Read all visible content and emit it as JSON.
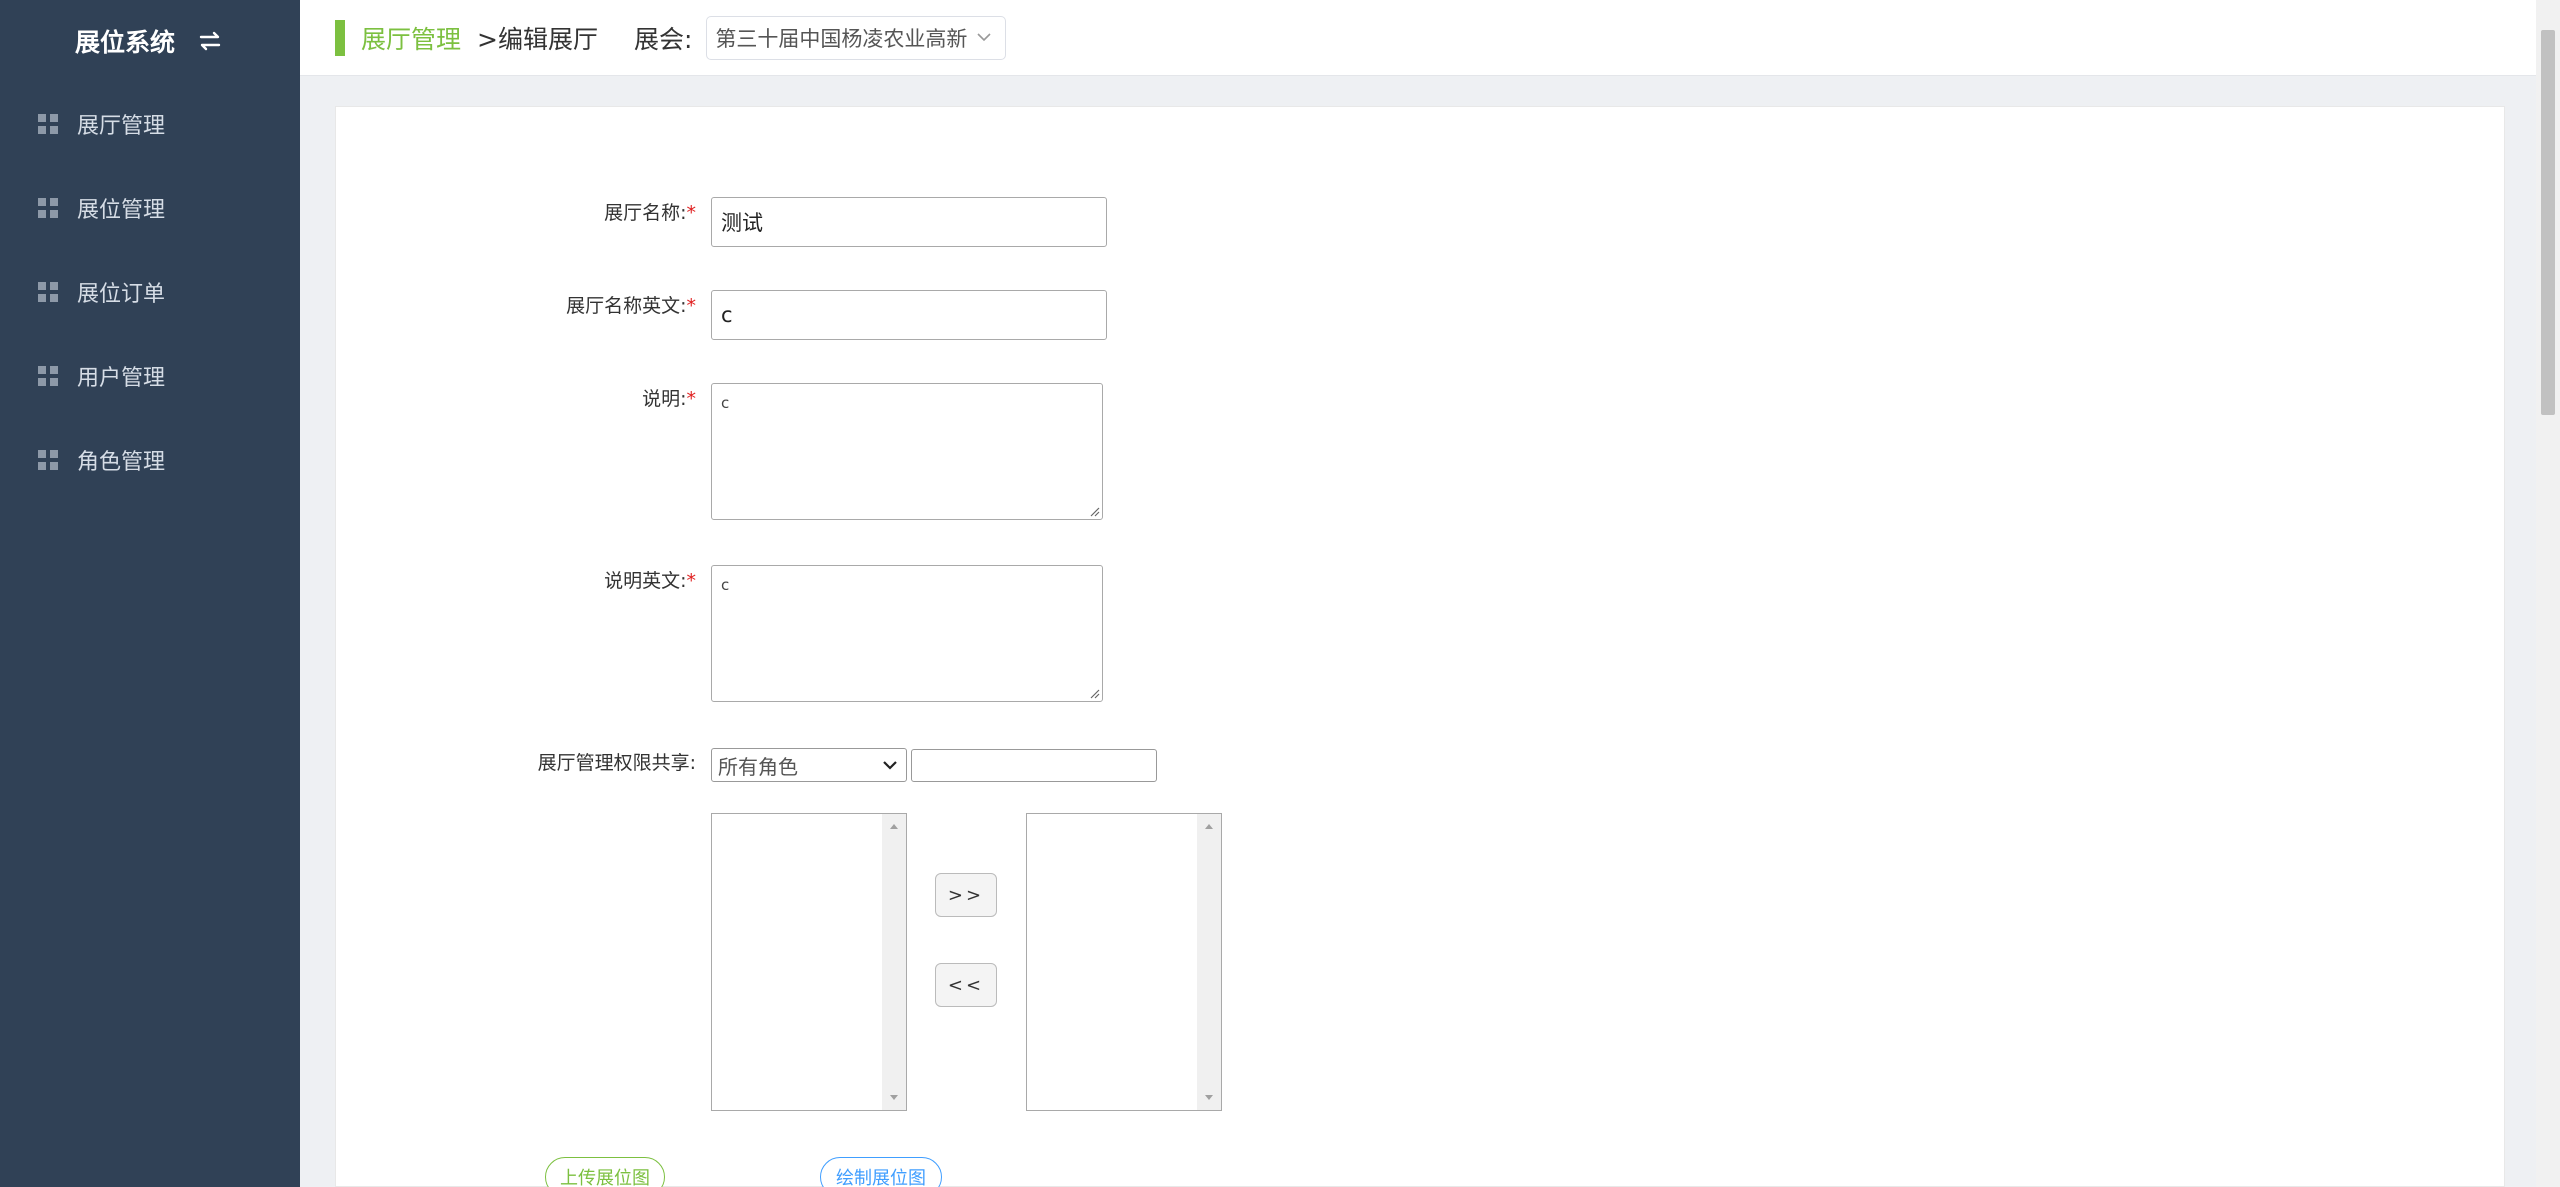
{
  "sidebar": {
    "brand": "展位系统",
    "items": [
      {
        "label": "展厅管理"
      },
      {
        "label": "展位管理"
      },
      {
        "label": "展位订单"
      },
      {
        "label": "用户管理"
      },
      {
        "label": "角色管理"
      }
    ]
  },
  "topbar": {
    "crumb_main": "展厅管理",
    "crumb_sub": ">编辑展厅",
    "expo_label": "展会:",
    "expo_value": "第三十届中国杨凌农业高新"
  },
  "form": {
    "name_label": "展厅名称:",
    "name_value": "测试",
    "name_en_label": "展厅名称英文:",
    "name_en_value": "c",
    "desc_label": "说明:",
    "desc_value": "c",
    "desc_en_label": "说明英文:",
    "desc_en_value": "c",
    "share_label": "展厅管理权限共享:",
    "role_select_value": "所有角色",
    "role_search_value": "",
    "move_right": ">>",
    "move_left": "<<",
    "upload_button": "上传展位图",
    "draw_button": "绘制展位图",
    "required_mark": "*"
  },
  "colors": {
    "sidebar_bg": "#304156",
    "accent_green": "#7cc040",
    "link_blue": "#409eff",
    "required_red": "#e02020"
  }
}
